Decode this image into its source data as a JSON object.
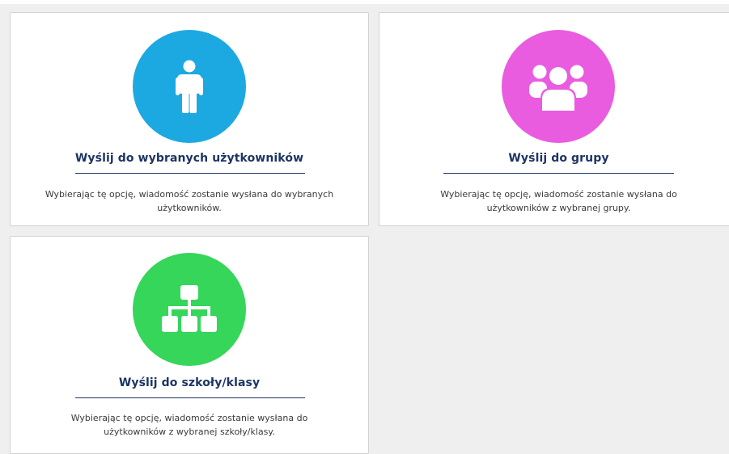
{
  "colors": {
    "page_bg": "#efefef",
    "title": "#1c3563",
    "users_circle": "#1ca9e2",
    "group_circle": "#e95bdf",
    "school_circle": "#35d65a"
  },
  "cards": [
    {
      "icon": "person-icon",
      "title": "Wyślij do wybranych użytkowników",
      "desc_line1": "Wybierając tę opcję, wiadomość zostanie wysłana do wybranych",
      "desc_line2": "użytkowników."
    },
    {
      "icon": "group-icon",
      "title": "Wyślij do grupy",
      "desc_line1": "Wybierając tę opcję, wiadomość zostanie wysłana do",
      "desc_line2": "użytkowników z wybranej grupy."
    },
    {
      "icon": "hierarchy-icon",
      "title": "Wyślij do szkoły/klasy",
      "desc_line1": "Wybierając tę opcję, wiadomość zostanie wysłana do",
      "desc_line2": "użytkowników z wybranej szkoły/klasy."
    }
  ]
}
